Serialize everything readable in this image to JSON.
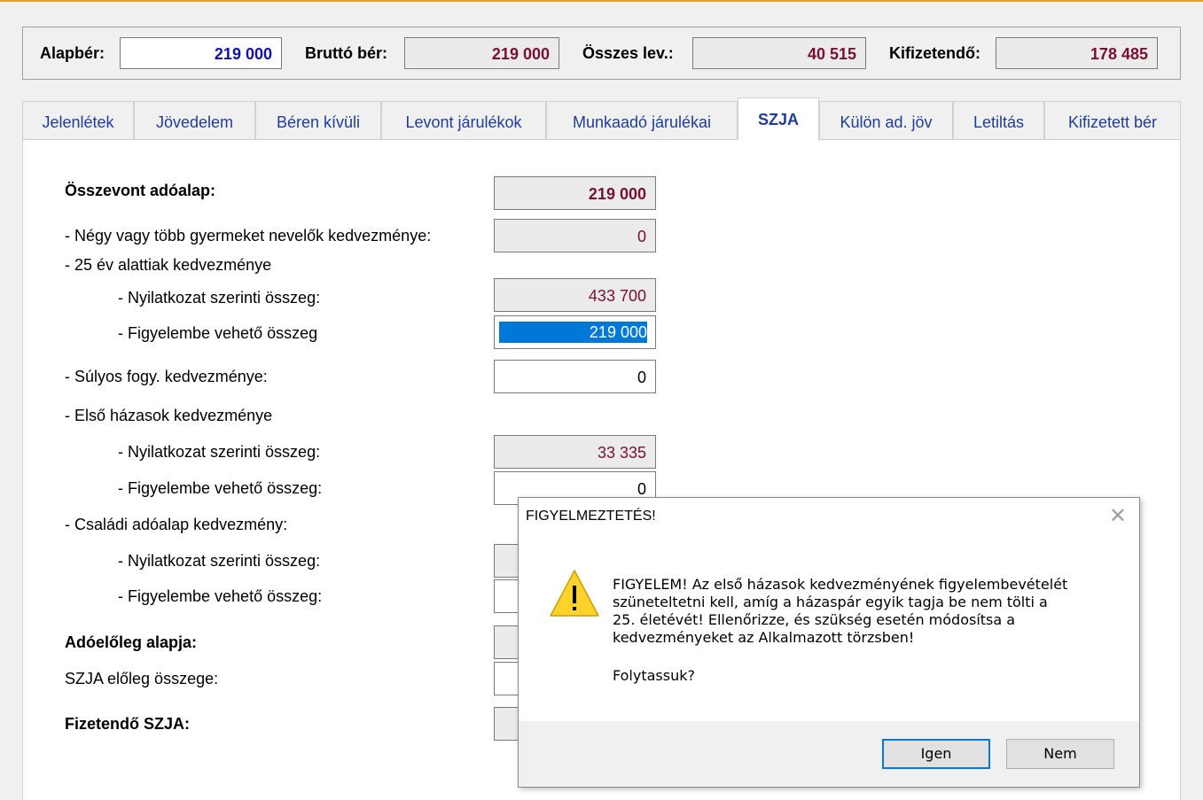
{
  "summary": {
    "alapber_label": "Alapbér:",
    "alapber_value": "219 000",
    "brutto_label": "Bruttó bér:",
    "brutto_value": "219 000",
    "osszes_lev_label": "Összes lev.:",
    "osszes_lev_value": "40 515",
    "kifizetendo_label": "Kifizetendő:",
    "kifizetendo_value": "178 485"
  },
  "tabs": [
    {
      "label": "Jelenlétek"
    },
    {
      "label": "Jövedelem"
    },
    {
      "label": "Béren kívüli"
    },
    {
      "label": "Levont járulékok"
    },
    {
      "label": "Munkaadó járulékai"
    },
    {
      "label": "SZJA"
    },
    {
      "label": "Külön ad. jöv"
    },
    {
      "label": "Letiltás"
    },
    {
      "label": "Kifizetett bér"
    }
  ],
  "active_tab": "SZJA",
  "form": {
    "osszevont_label": "Összevont adóalap:",
    "osszevont_value": "219 000",
    "negy_gyermek_label": "- Négy vagy több gyermeket nevelők kedvezménye:",
    "negy_gyermek_value": "0",
    "ev25_label": "- 25 év alattiak kedvezménye",
    "ev25_nyilatkozat_label": "- Nyilatkozat szerinti összeg:",
    "ev25_nyilatkozat_value": "433 700",
    "ev25_figyelembe_label": "- Figyelembe vehető összeg",
    "ev25_figyelembe_value": "219 000",
    "sulyos_label": "- Súlyos fogy. kedvezménye:",
    "sulyos_value": "0",
    "elso_hazasok_label": "- Első házasok kedvezménye",
    "elso_nyilatkozat_label": "- Nyilatkozat szerinti összeg:",
    "elso_nyilatkozat_value": "33 335",
    "elso_figyelembe_label": "- Figyelembe vehető összeg:",
    "elso_figyelembe_value": "0",
    "csaladi_label": "- Családi adóalap kedvezmény:",
    "csaladi_nyilatkozat_label": "- Nyilatkozat szerinti összeg:",
    "csaladi_figyelembe_label": "- Figyelembe vehető összeg:",
    "adoeloleg_alapja_label": "Adóelőleg alapja:",
    "szja_eloleg_label": "SZJA előleg összege:",
    "fizetendo_label": "Fizetendő SZJA:"
  },
  "dialog": {
    "title": "FIGYELMEZTETÉS!",
    "close_glyph": "✕",
    "message_line1": "FIGYELEM! Az első házasok kedvezményének figyelembevételét",
    "message_line2": "szüneteltetni kell, amíg a házaspár egyik tagja be nem tölti a",
    "message_line3": "25. életévét! Ellenőrizze, és szükség esetén módosítsa a",
    "message_line4": "kedvezményeket az Alkalmazott törzsben!",
    "question": "Folytassuk?",
    "yes_label": "Igen",
    "no_label": "Nem",
    "icon": "warning-icon"
  },
  "colors": {
    "tab_text": "#1f3c9a",
    "value_red": "#7a1030",
    "value_blue": "#1010b0",
    "selection": "#0078d7",
    "top_line": "#e0a030"
  }
}
